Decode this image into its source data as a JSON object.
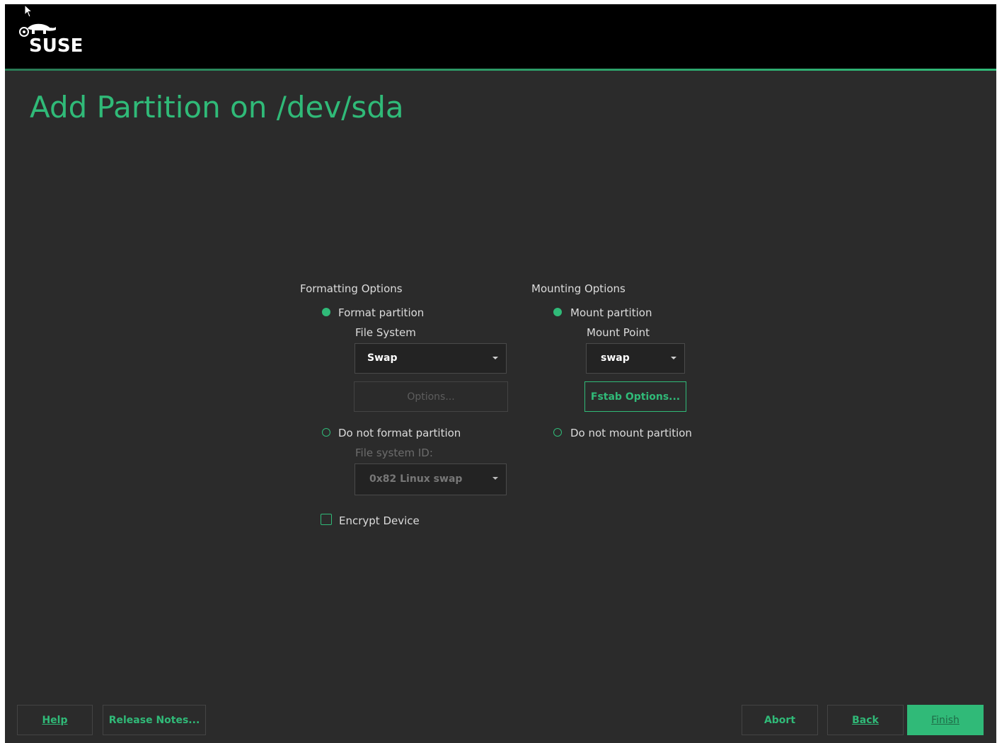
{
  "brand": {
    "logo_text": "SUSE",
    "accent_color": "#30ba78",
    "background_color": "#2b2b2b",
    "header_color": "#000000"
  },
  "page": {
    "title": "Add Partition on /dev/sda"
  },
  "formatting": {
    "section_label": "Formatting Options",
    "format_partition": {
      "label": "Format partition",
      "selected": true
    },
    "file_system_label": "File System",
    "file_system_value": "Swap",
    "options_button": "Options...",
    "do_not_format": {
      "label": "Do not format partition",
      "selected": false
    },
    "file_system_id_label": "File system ID:",
    "file_system_id_value": "0x82 Linux swap"
  },
  "encrypt": {
    "label": "Encrypt Device",
    "checked": false
  },
  "mounting": {
    "section_label": "Mounting Options",
    "mount_partition": {
      "label": "Mount partition",
      "selected": true
    },
    "mount_point_label": "Mount Point",
    "mount_point_value": "swap",
    "fstab_button": "Fstab Options...",
    "do_not_mount": {
      "label": "Do not mount partition",
      "selected": false
    }
  },
  "footer": {
    "help": "Help",
    "release_notes": "Release Notes...",
    "abort": "Abort",
    "back": "Back",
    "finish": "Finish"
  },
  "icons": {
    "logo": "suse-chameleon-logo",
    "cursor": "mouse-pointer-icon",
    "dropdown": "chevron-down-icon"
  }
}
